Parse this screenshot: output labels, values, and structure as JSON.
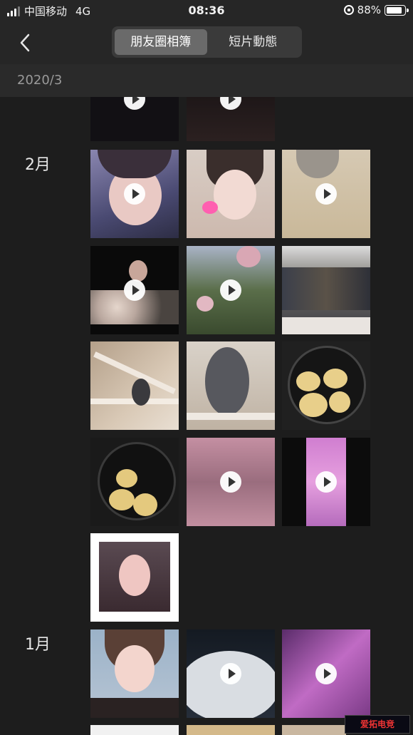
{
  "status_bar": {
    "carrier": "中国移动",
    "network": "4G",
    "time": "08:36",
    "battery": "88%",
    "battery_level": 0.88
  },
  "nav": {
    "tabs": [
      {
        "label": "朋友圈相簿",
        "active": true
      },
      {
        "label": "短片動態",
        "active": false
      }
    ]
  },
  "section_header": "2020/3",
  "months": [
    "2月",
    "1月"
  ],
  "watermark": "爱拓电竞",
  "colors": {
    "background": "#1d1d1d",
    "bar": "#262626",
    "segment_active": "#6a6a6a"
  }
}
